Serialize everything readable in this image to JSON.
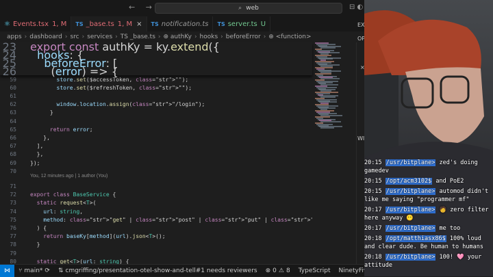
{
  "titlebar": {
    "back": "←",
    "forward": "→",
    "search_icon": "search-icon",
    "search_text": "web",
    "right_icons": "⊟ ◐"
  },
  "tabs": [
    {
      "lang": "",
      "label": "Events.tsx",
      "status": "1, M",
      "active": false
    },
    {
      "lang": "TS",
      "label": "_base.ts",
      "status": "1, M",
      "active": true
    },
    {
      "lang": "TS",
      "label": "notification.ts",
      "status": "",
      "active": false
    },
    {
      "lang": "TS",
      "label": "server.ts",
      "status": "U",
      "active": false
    }
  ],
  "breadcrumb": [
    "apps",
    "dashboard",
    "src",
    "services",
    "TS _base.ts",
    "⊕ authKy",
    "hooks",
    "beforeError",
    "⊕ <function>"
  ],
  "sticky_lines": [
    {
      "n": "23",
      "text": "export const authKy = ky.extend({"
    },
    {
      "n": "24",
      "text": "  hooks: {"
    },
    {
      "n": "25",
      "text": "    beforeError: ["
    },
    {
      "n": "26",
      "text": "      (error) => {"
    }
  ],
  "lines": [
    {
      "n": "59",
      "text": "        store.set($accessToken, \"\");"
    },
    {
      "n": "60",
      "text": "        store.set($refreshToken, \"\");"
    },
    {
      "n": "61",
      "text": ""
    },
    {
      "n": "62",
      "text": "        window.location.assign(\"/login\");"
    },
    {
      "n": "63",
      "text": "      }"
    },
    {
      "n": "64",
      "text": ""
    },
    {
      "n": "65",
      "text": "      return error;"
    },
    {
      "n": "66",
      "text": "    },"
    },
    {
      "n": "67",
      "text": "  ],"
    },
    {
      "n": "68",
      "text": "  },"
    },
    {
      "n": "69",
      "text": "});"
    },
    {
      "n": "70",
      "text": ""
    },
    {
      "n": "71",
      "text": ""
    },
    {
      "n": "72",
      "text": "export class BaseService {"
    },
    {
      "n": "73",
      "text": "  static request<T>("
    },
    {
      "n": "74",
      "text": "    url: string,"
    },
    {
      "n": "75",
      "text": "    method: \"get\" | \"post\" | \"put\" | \"patch\" | \"delete\","
    },
    {
      "n": "76",
      "text": "  ) {"
    },
    {
      "n": "77",
      "text": "    return baseKy[method](url).json<T>();"
    },
    {
      "n": "78",
      "text": "  }"
    },
    {
      "n": "79",
      "text": ""
    },
    {
      "n": "80",
      "text": "  static get<T>(url: string) {"
    }
  ],
  "blame": "You, 12 minutes ago | 1 author (You)",
  "statusbar": {
    "branch": "main*",
    "sync": "⟳",
    "pr": "cmgriffing/presentation-otel-show-and-tell#1 needs reviewers",
    "errors": "0",
    "warnings": "8",
    "language": "TypeScript",
    "right": "NinetyFive F"
  },
  "side_labels": {
    "ex": "EX",
    "op": "OP",
    "wi": "WI"
  },
  "chat": [
    {
      "time": "20:15",
      "user": "/usr/bitplane>",
      "text": " zed's doing gamedev"
    },
    {
      "time": "20:15",
      "user": "/opt/acm3102$",
      "text": " and PoE2"
    },
    {
      "time": "20:15",
      "user": "/usr/bitplane>",
      "text": " automod didn't like me saying \"programmer mf\""
    },
    {
      "time": "20:17",
      "user": "/usr/bitplane>",
      "text": " 🧑 zero filter here anyway 😶"
    },
    {
      "time": "20:17",
      "user": "/usr/bitplane>",
      "text": " me too"
    },
    {
      "time": "20:18",
      "user": "/opt/matthiasx86$",
      "text": " 100% loud and clear dude. Be human to humans"
    },
    {
      "time": "20:18",
      "user": "/usr/bitplane>",
      "text": " 100! 🩷 your attitude"
    }
  ]
}
